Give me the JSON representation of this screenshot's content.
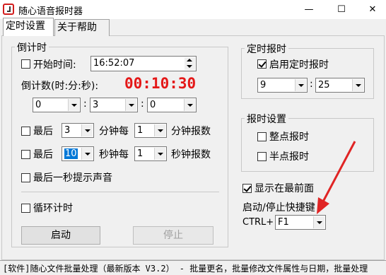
{
  "window": {
    "title": "随心语音报时器",
    "minimize": "—",
    "maximize": "☐",
    "close": "✕"
  },
  "tabs": [
    "定时设置",
    "关于帮助"
  ],
  "countdown": {
    "title": "倒计时",
    "start_time_label": "开始时间:",
    "start_time_value": "16:52:07",
    "count_label": "倒计数(时:分:秒):",
    "display": "00:10:30",
    "hours": "0",
    "minutes": "3",
    "seconds": "0",
    "colon": ":",
    "last_label": "最后",
    "last_min_value": "3",
    "minute_every_label": "分钟每",
    "every_min_value": "1",
    "minute_report_label": "分钟报数",
    "last_sec_value": "10",
    "second_every_label": "秒钟每",
    "every_sec_value": "1",
    "second_report_label": "秒钟报数",
    "last_second_sound_label": "最后一秒提示声音",
    "loop_label": "循环计时",
    "start_button": "启动",
    "stop_button": "停止"
  },
  "timed_report": {
    "title": "定时报时",
    "enable_label": "启用定时报时",
    "hour_value": "9",
    "minute_value": "25",
    "colon": ":"
  },
  "report_settings": {
    "title": "报时设置",
    "hourly_label": "整点报时",
    "half_hour_label": "半点报时"
  },
  "always_on_top_label": "显示在最前面",
  "hotkey": {
    "label": "启动/停止快捷键",
    "modifier": "CTRL+",
    "value": "F1"
  },
  "statusbar": "[软件]随心文件批量处理（最新版本 V3.2） - 批量更名，批量修改文件属性与日期，批量处理"
}
